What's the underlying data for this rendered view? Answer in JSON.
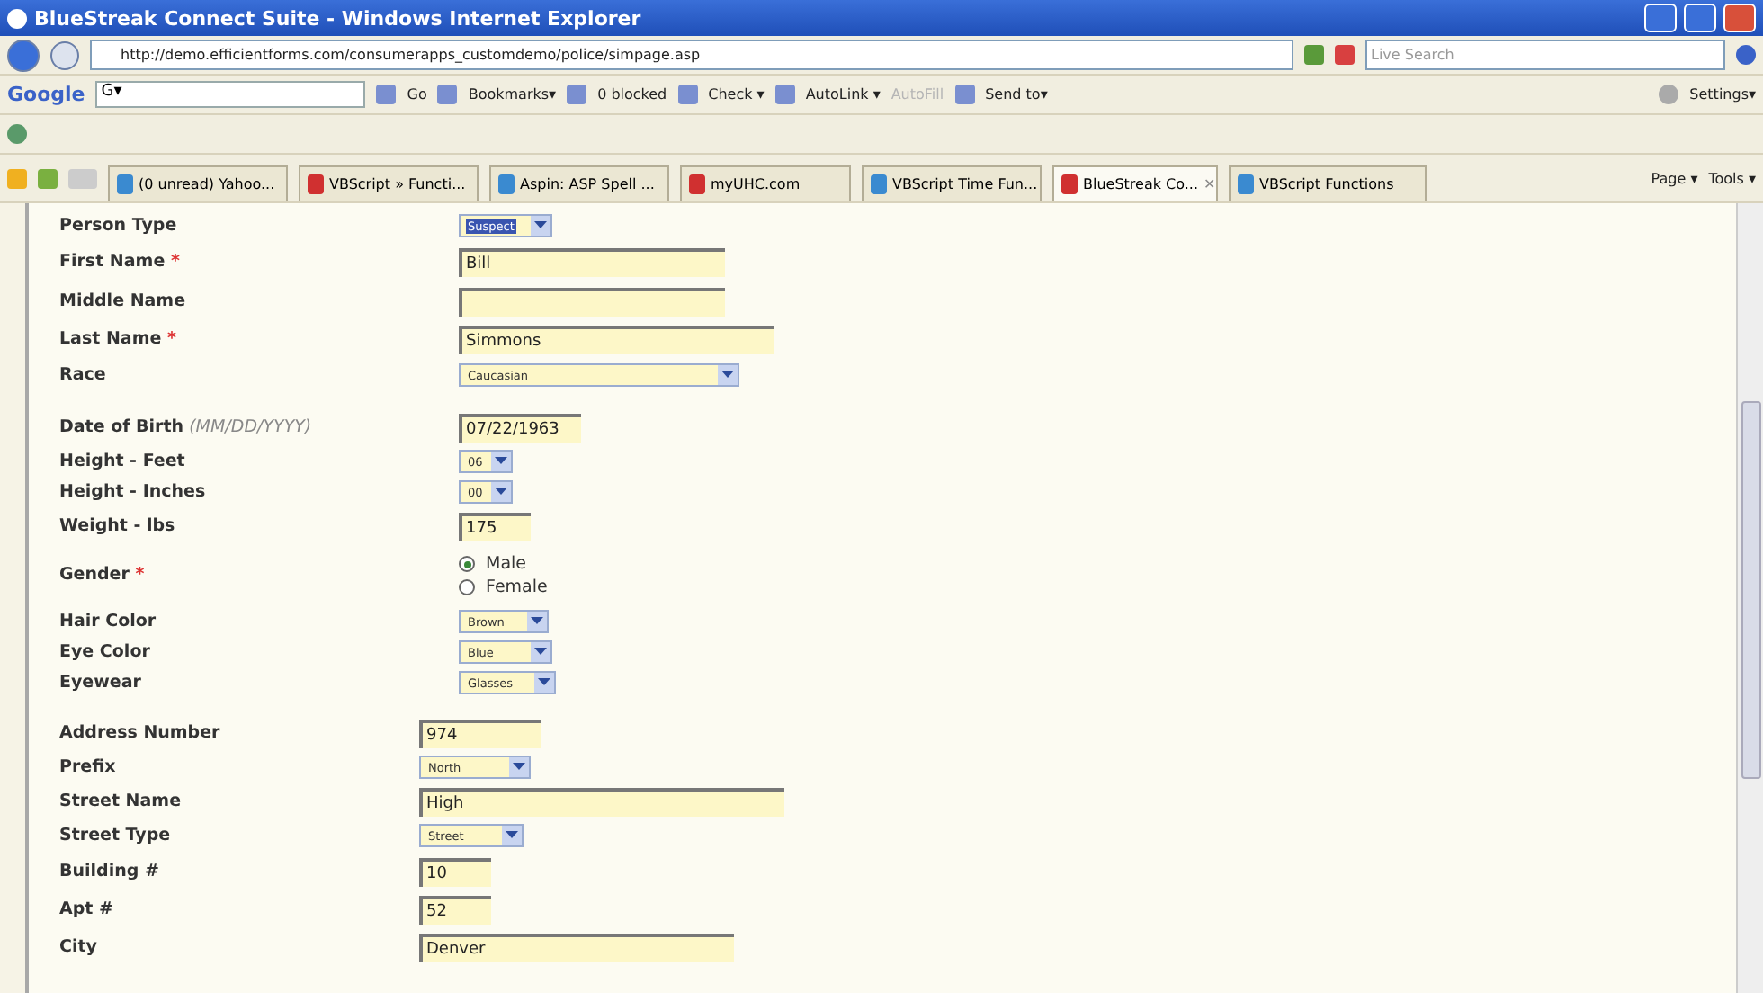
{
  "window": {
    "title": "BlueStreak Connect Suite - Windows Internet Explorer"
  },
  "address_bar": {
    "url": "http://demo.efficientforms.com/consumerapps_customdemo/police/simpage.asp"
  },
  "search": {
    "placeholder": "Live Search"
  },
  "google_toolbar": {
    "logo": "Google",
    "search_label": "G▾",
    "items": [
      {
        "kind": "text",
        "label": "Go"
      },
      {
        "kind": "menu",
        "label": "Bookmarks▾"
      },
      {
        "kind": "text",
        "label": "0 blocked"
      },
      {
        "kind": "menu",
        "label": "Check ▾"
      },
      {
        "kind": "menu",
        "label": "AutoLink ▾"
      },
      {
        "kind": "disabled",
        "label": "AutoFill"
      },
      {
        "kind": "menu",
        "label": "Send to▾"
      }
    ],
    "settings": "Settings▾"
  },
  "tabs": [
    {
      "label": "(0 unread) Yahoo...",
      "selected": false
    },
    {
      "label": "VBScript » Functi...",
      "selected": false
    },
    {
      "label": "Aspin: ASP Spell ...",
      "selected": false
    },
    {
      "label": "myUHC.com",
      "selected": false
    },
    {
      "label": "VBScript Time Fun...",
      "selected": false
    },
    {
      "label": "BlueStreak Co...",
      "selected": true,
      "close": "✕"
    },
    {
      "label": "VBScript Functions",
      "selected": false
    }
  ],
  "command_bar": [
    "Page ▾",
    "Tools ▾"
  ],
  "form": {
    "sections": [
      {
        "fields": [
          {
            "label": "Person Type",
            "kind": "select",
            "value": "Suspect",
            "focused": true
          },
          {
            "label": "First Name",
            "required_mark": "*",
            "kind": "text",
            "value": "Bill"
          },
          {
            "label": "Middle Name",
            "kind": "text"
          },
          {
            "label": "Last Name",
            "required_mark": "*",
            "kind": "text",
            "value": "Simmons"
          },
          {
            "label": "Race",
            "kind": "select",
            "value": "Caucasian",
            "focused": false
          }
        ]
      },
      {
        "fields": [
          {
            "label": "Date of Birth",
            "hint": "(MM/DD/YYYY)",
            "kind": "text",
            "value": "07/22/1963"
          },
          {
            "label": "Height - Feet",
            "kind": "select",
            "value": "06",
            "focused": false
          },
          {
            "label": "Height - Inches",
            "kind": "select",
            "value": "00",
            "focused": false
          },
          {
            "label": "Weight - lbs",
            "kind": "text",
            "value": "175"
          },
          {
            "label": "Gender",
            "required_mark": "*",
            "kind": "radio",
            "options": [
              {
                "label": "Male",
                "selected": true
              },
              {
                "label": "Female",
                "selected": false
              }
            ]
          },
          {
            "label": "Hair Color",
            "kind": "select",
            "value": "Brown",
            "focused": false
          },
          {
            "label": "Eye Color",
            "kind": "select",
            "value": "Blue",
            "focused": false
          },
          {
            "label": "Eyewear",
            "kind": "select",
            "value": "Glasses",
            "focused": false
          }
        ]
      },
      {
        "fields": [
          {
            "label": "Address Number",
            "kind": "text",
            "value": "974"
          },
          {
            "label": "Prefix",
            "kind": "select",
            "value": "North",
            "focused": false
          },
          {
            "label": "Street Name",
            "kind": "text",
            "value": "High"
          },
          {
            "label": "Street Type",
            "kind": "select",
            "value": "Street",
            "focused": false
          },
          {
            "label": "Building #",
            "kind": "text",
            "value": "10"
          },
          {
            "label": "Apt #",
            "kind": "text",
            "value": "52"
          },
          {
            "label": "City",
            "kind": "text",
            "value": "Denver"
          }
        ]
      }
    ]
  }
}
